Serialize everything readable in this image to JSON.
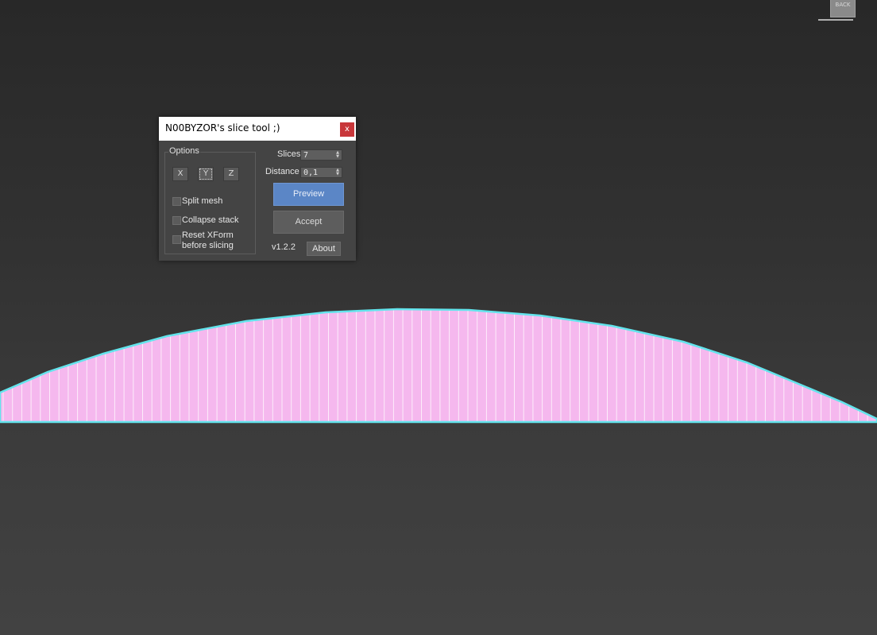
{
  "viewport": {
    "viewcube_label": "BACK",
    "mesh_fill_color": "#f5b8ee",
    "mesh_edge_color": "#63e4ec",
    "mesh_slice_line_color": "#ffffff"
  },
  "dialog": {
    "title": "N00BYZOR's slice tool ;)",
    "close_label": "x",
    "options_label": "Options",
    "axis_buttons": [
      "X",
      "Y",
      "Z"
    ],
    "selected_axis": "Y",
    "checkboxes": [
      {
        "label_lines": [
          "Split mesh"
        ],
        "checked": false
      },
      {
        "label_lines": [
          "Collapse stack"
        ],
        "checked": false
      },
      {
        "label_lines": [
          "Reset XForm",
          "before slicing"
        ],
        "checked": false
      }
    ],
    "slices_label": "Slices",
    "slices_value": "7",
    "distance_label": "Distance",
    "distance_value": "0,1",
    "preview_label": "Preview",
    "accept_label": "Accept",
    "version": "v1.2.2",
    "about_label": "About",
    "colors": {
      "panel_bg": "#444444",
      "preview_accent": "#5b86c6",
      "close_red": "#c8373a"
    }
  }
}
